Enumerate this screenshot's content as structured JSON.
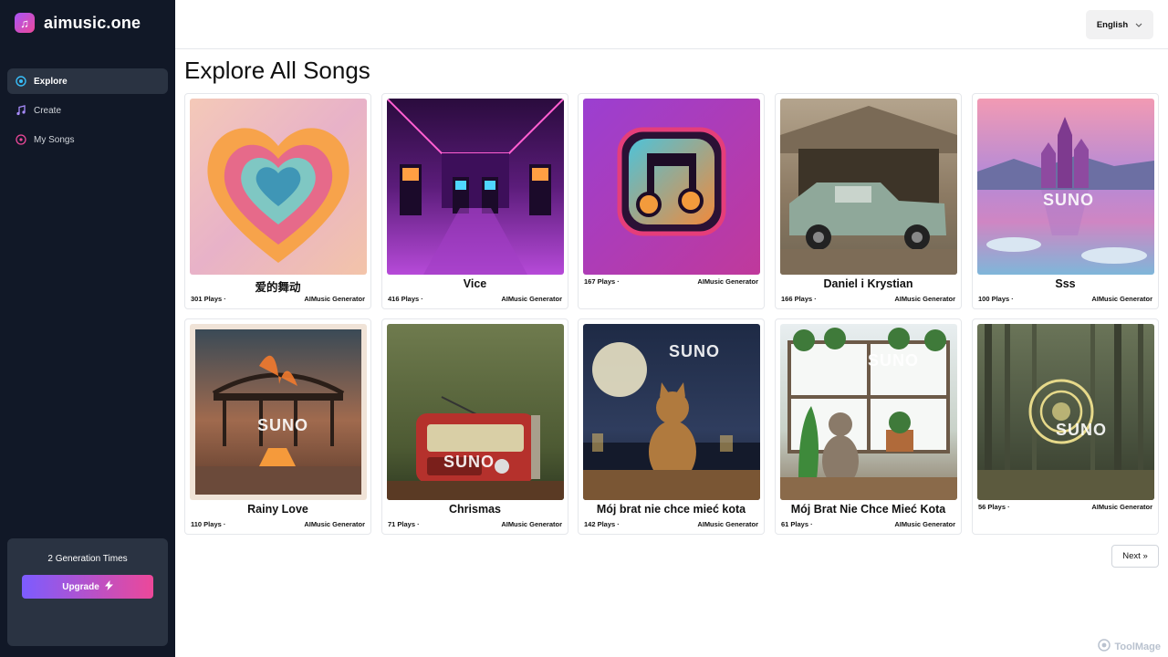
{
  "app": {
    "name": "aimusic.one"
  },
  "sidebar": {
    "items": [
      {
        "label": "Explore",
        "icon": "explore-icon"
      },
      {
        "label": "Create",
        "icon": "music-note-icon"
      },
      {
        "label": "My Songs",
        "icon": "record-icon"
      }
    ],
    "generation_text": "2 Generation Times",
    "upgrade_label": "Upgrade"
  },
  "header": {
    "language": "English"
  },
  "main": {
    "title": "Explore All Songs",
    "songs": [
      {
        "title": "爱的舞动",
        "plays": "301 Plays ·",
        "generator": "AIMusic Generator"
      },
      {
        "title": "Vice",
        "plays": "416 Plays ·",
        "generator": "AIMusic Generator"
      },
      {
        "title": "",
        "plays": "167 Plays ·",
        "generator": "AIMusic Generator"
      },
      {
        "title": "Daniel i Krystian",
        "plays": "166 Plays ·",
        "generator": "AIMusic Generator"
      },
      {
        "title": "Sss",
        "plays": "100 Plays ·",
        "generator": "AIMusic Generator"
      },
      {
        "title": "Rainy Love",
        "plays": "110 Plays ·",
        "generator": "AIMusic Generator"
      },
      {
        "title": "Chrismas",
        "plays": "71 Plays ·",
        "generator": "AIMusic Generator"
      },
      {
        "title": "Mój brat nie chce mieć kota",
        "plays": "142 Plays ·",
        "generator": "AIMusic Generator"
      },
      {
        "title": "Mój Brat Nie Chce Mieć Kota",
        "plays": "61 Plays ·",
        "generator": "AIMusic Generator"
      },
      {
        "title": "",
        "plays": "56 Plays ·",
        "generator": "AIMusic Generator"
      }
    ],
    "suno_mark": "SUNO",
    "next_label": "Next »"
  },
  "watermark": "ToolMage",
  "colors": {
    "sidebar_bg": "#111827",
    "active_bg": "#2a3342",
    "upgrade_from": "#7c5cff",
    "upgrade_to": "#ec4899"
  }
}
